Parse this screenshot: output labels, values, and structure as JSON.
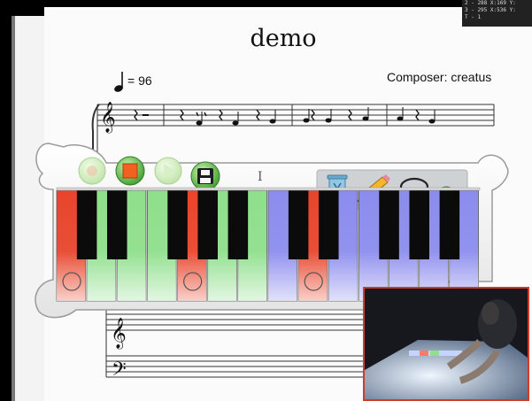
{
  "score": {
    "title": "demo",
    "tempo_text": "= 96",
    "composer_text": "Composer: creatus"
  },
  "debug_overlay": {
    "lines": [
      "2 - 288 X:169 Y:",
      "3 - 295 X:536 Y:",
      "T - 1"
    ]
  },
  "piano_widget": {
    "transport": {
      "record": "record-button",
      "stop": "stop-button",
      "play": "play-button",
      "save": "save-button"
    },
    "tools": [
      "trash-can-icon",
      "pencil-icon",
      "lasso-icon",
      "add-icon"
    ],
    "text_cursor": "I",
    "colors": {
      "red": "#e8452c",
      "green": "#8fdf8c",
      "blue": "#8c8cee",
      "black_key": "#0b0b0b",
      "panel": "#f4f4f4"
    },
    "white_keys": [
      {
        "color": "red",
        "marker": true
      },
      {
        "color": "green",
        "marker": false
      },
      {
        "color": "green",
        "marker": false
      },
      {
        "color": "green",
        "marker": false
      },
      {
        "color": "red",
        "marker": true
      },
      {
        "color": "green",
        "marker": false
      },
      {
        "color": "green",
        "marker": false
      },
      {
        "color": "blue",
        "marker": false
      },
      {
        "color": "red",
        "marker": true
      },
      {
        "color": "blue",
        "marker": false
      },
      {
        "color": "blue",
        "marker": false
      },
      {
        "color": "blue",
        "marker": false
      },
      {
        "color": "blue",
        "marker": false
      },
      {
        "color": "blue",
        "marker": false
      }
    ]
  },
  "video_inset": {
    "label": "camera-inset"
  }
}
